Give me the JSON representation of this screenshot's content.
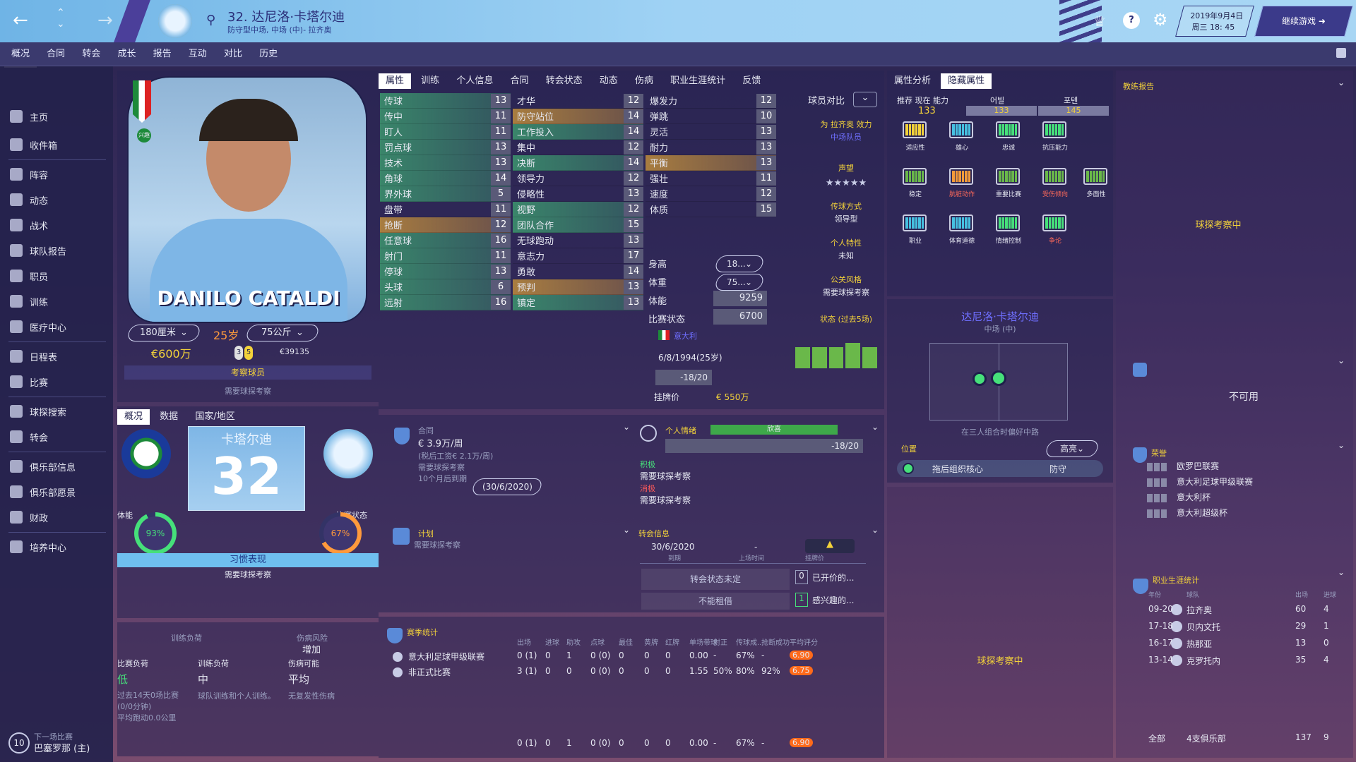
{
  "topbar": {
    "player_title": "32. 达尼洛·卡塔尔迪",
    "player_subtitle": "防守型中场, 中场 (中)- 拉齐奥",
    "date": "2019年9月4日",
    "time": "周三 18: 45",
    "continue": "继续游戏"
  },
  "subnav": [
    "概况",
    "合同",
    "转会",
    "成长",
    "报告",
    "互动",
    "对比",
    "历史"
  ],
  "sidebar": {
    "items": [
      "主页",
      "收件箱",
      "阵容",
      "动态",
      "战术",
      "球队报告",
      "职员",
      "训练",
      "医疗中心",
      "日程表",
      "比赛",
      "球探搜索",
      "转会",
      "俱乐部信息",
      "俱乐部愿景",
      "财政",
      "培养中心"
    ],
    "next_match_label": "下一场比赛",
    "next_match": "巴塞罗那 (主)",
    "next_match_badge": "10"
  },
  "player": {
    "name_on_card": "DANILO CATALDI",
    "height": "180厘米",
    "age": "25岁",
    "weight": "75公斤",
    "value": "€600万",
    "wage_small": "€39135",
    "feet_left": "3",
    "feet_right": "5",
    "star_label": "兴趣",
    "scout_btn": "考察球员",
    "scout_note": "需要球探考察"
  },
  "info_tabs": [
    "概况",
    "数据",
    "国家/地区"
  ],
  "shirt": {
    "name": "卡塔尔迪",
    "number": "32"
  },
  "fitness": {
    "label_left": "体能",
    "pct_left": "93%",
    "label_right": "比赛状态",
    "pct_right": "67%",
    "pct_left_value": 93,
    "pct_right_value": 67
  },
  "habit": {
    "title": "习惯表现",
    "note": "需要球探考察"
  },
  "load": {
    "col1": "训练负荷",
    "col2": "伤病风险",
    "col2_val": "增加",
    "h1": "比赛负荷",
    "h2": "训练负荷",
    "h3": "伤病可能",
    "v1": "低",
    "v2": "中",
    "v3": "平均",
    "n1": "过去14天0场比赛 (0/0分钟)\n平均跑动0.0公里",
    "n2": "球队训练和个人训练。",
    "n3": "无复发性伤病"
  },
  "attr_tabs": [
    "属性",
    "训练",
    "个人信息",
    "合同",
    "转会状态",
    "动态",
    "伤病",
    "职业生涯统计",
    "反馈"
  ],
  "technical": [
    [
      "传球",
      "13"
    ],
    [
      "传中",
      "11"
    ],
    [
      "盯人",
      "11"
    ],
    [
      "罚点球",
      "13"
    ],
    [
      "技术",
      "13"
    ],
    [
      "角球",
      "14"
    ],
    [
      "界外球",
      "5"
    ],
    [
      "盘带",
      "11"
    ],
    [
      "抢断",
      "12"
    ],
    [
      "任意球",
      "16"
    ],
    [
      "射门",
      "11"
    ],
    [
      "停球",
      "13"
    ],
    [
      "头球",
      "6"
    ],
    [
      "远射",
      "16"
    ]
  ],
  "mental": [
    [
      "才华",
      "12"
    ],
    [
      "防守站位",
      "14"
    ],
    [
      "工作投入",
      "14"
    ],
    [
      "集中",
      "12"
    ],
    [
      "决断",
      "14"
    ],
    [
      "领导力",
      "12"
    ],
    [
      "侵略性",
      "13"
    ],
    [
      "视野",
      "12"
    ],
    [
      "团队合作",
      "15"
    ],
    [
      "无球跑动",
      "13"
    ],
    [
      "意志力",
      "17"
    ],
    [
      "勇敢",
      "14"
    ],
    [
      "预判",
      "13"
    ],
    [
      "镇定",
      "13"
    ]
  ],
  "physical": [
    [
      "爆发力",
      "12"
    ],
    [
      "弹跳",
      "10"
    ],
    [
      "灵活",
      "13"
    ],
    [
      "耐力",
      "13"
    ],
    [
      "平衡",
      "13"
    ],
    [
      "强壮",
      "11"
    ],
    [
      "速度",
      "12"
    ],
    [
      "体质",
      "15"
    ]
  ],
  "phys_extra": {
    "height_l": "身高",
    "height_v": "18...",
    "weight_l": "体重",
    "weight_v": "75...",
    "fitness_l": "体能",
    "fitness_v": "9259",
    "form_l": "比赛状态",
    "form_v": "6700",
    "nation": "意大利",
    "dob": "6/8/1994(25岁)",
    "rating": "-18/20",
    "price_l": "挂牌价",
    "price_v": "€ 550万"
  },
  "compare": {
    "label": "球员对比",
    "plays_for": "为 拉齐奥 效力",
    "role": "中场队员",
    "rep": "声望",
    "stars": "★★★★★",
    "pass_style": "传球方式",
    "pass_val": "领导型",
    "personality": "个人特性",
    "personality_val": "未知",
    "media": "公关风格",
    "media_val": "需要球探考察",
    "form_label": "状态 (过去5场)"
  },
  "analysis": {
    "tab1": "属性分析",
    "tab2": "隐藏属性",
    "ca_label": "推荐",
    "ca_label2": "现在",
    "ca_label3": "能力",
    "ca_val": "133",
    "pa_label": "어빌",
    "pa_val": "133",
    "pa2_label": "포텐",
    "pa2_val": "145",
    "batteries": [
      "适应性",
      "雄心",
      "忠诚",
      "抗压能力",
      "稳定",
      "肮脏动作",
      "重要比赛",
      "受伤倾向",
      "多面性",
      "职业",
      "体育道德",
      "情绪控制",
      "争论"
    ]
  },
  "pitch": {
    "name": "达尼洛·卡塔尔迪",
    "pos": "中场 (中)",
    "note": "在三人组合时偏好中路",
    "pos_link": "位置",
    "highlight": "高亮",
    "role": "拖后组织核心",
    "duty": "防守"
  },
  "contract": {
    "title": "合同",
    "wage": "€ 3.9万/周",
    "tax": "(税后工资€ 2.1万/周)",
    "note": "需要球探考察",
    "expire": "10个月后到期",
    "date": "(30/6/2020)"
  },
  "mood": {
    "title": "个人情绪",
    "state": "欣喜",
    "score": "-18/20",
    "pos": "积极",
    "pos_note": "需要球探考察",
    "neg": "消极",
    "neg_note": "需要球探考察"
  },
  "plan": {
    "title": "计划",
    "note": "需要球探考察"
  },
  "transfer": {
    "title": "转会信息",
    "date": "30/6/2020",
    "date_l": "到期",
    "apps": "-",
    "apps_l": "上场时间",
    "price_l": "挂牌价",
    "status": "转会状态未定",
    "loan": "不能租借",
    "offers_n": "0",
    "offers": "已开价的...",
    "interest_n": "1",
    "interest": "感兴趣的..."
  },
  "stats": {
    "title": "赛季统计",
    "cols": [
      "出场",
      "进球",
      "助攻",
      "点球",
      "最佳",
      "黄牌",
      "红牌",
      "单场带球",
      "射正",
      "传球成...",
      "抢断成功",
      "平均评分"
    ],
    "rows": [
      {
        "comp": "意大利足球甲级联赛",
        "vals": [
          "0 (1)",
          "0",
          "1",
          "0 (0)",
          "0",
          "0",
          "0",
          "0.00",
          "-",
          "67%",
          "-",
          "6.90"
        ]
      },
      {
        "comp": "非正式比赛",
        "vals": [
          "3 (1)",
          "0",
          "0",
          "0 (0)",
          "0",
          "0",
          "0",
          "1.55",
          "50%",
          "80%",
          "92%",
          "6.75"
        ]
      }
    ],
    "total": [
      "0 (1)",
      "0",
      "1",
      "0 (0)",
      "0",
      "0",
      "0",
      "0.00",
      "-",
      "67%",
      "-",
      "6.90"
    ]
  },
  "right": {
    "coach_report": "教练报告",
    "scouting": "球探考察中",
    "unavailable": "不可用",
    "honours": "荣誉",
    "honours_list": [
      "欧罗巴联赛",
      "意大利足球甲级联赛",
      "意大利杯",
      "意大利超级杯"
    ],
    "career": "职业生涯统计",
    "career_cols": [
      "年份",
      "球队",
      "出场",
      "进球"
    ],
    "career_rows": [
      [
        "09-20",
        "拉齐奥",
        "60",
        "4"
      ],
      [
        "17-18",
        "贝内文托",
        "29",
        "1"
      ],
      [
        "16-17",
        "热那亚",
        "13",
        "0"
      ],
      [
        "13-14",
        "克罗托内",
        "35",
        "4"
      ]
    ],
    "total_l": "全部",
    "total_clubs": "4支俱乐部",
    "total_apps": "137",
    "total_goals": "9",
    "scout_mid": "球探考察中"
  },
  "colors": {
    "accent": "#46e07a",
    "orange": "#ff9a3c",
    "topbar": "#8cc8ee"
  }
}
